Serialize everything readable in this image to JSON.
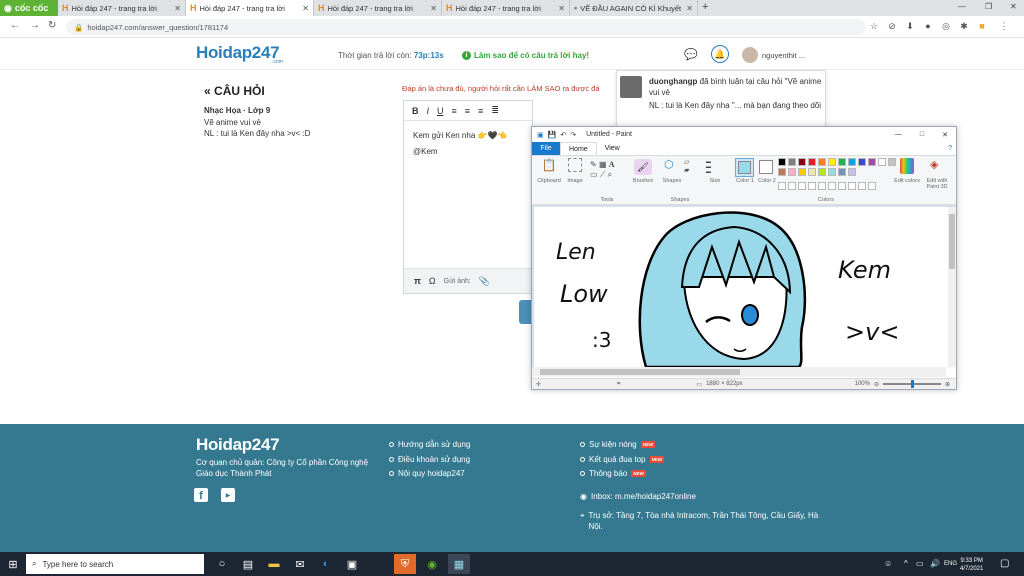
{
  "browser": {
    "brand": "cốc cốc",
    "tabs": [
      {
        "title": "Hỏi đáp 247 - trang tra lời",
        "active": false
      },
      {
        "title": "Hỏi đáp 247 - trang tra lời",
        "active": true
      },
      {
        "title": "Hỏi đáp 247 - trang tra lời",
        "active": false
      },
      {
        "title": "Hỏi đáp 247 - trang tra lời",
        "active": false
      },
      {
        "title": "VẼ ĐẦU AGAIN CÓ KÌ Khuyết",
        "active": false
      }
    ],
    "url": "hoidap247.com/answer_question/1781174"
  },
  "site": {
    "logo": "Hoidap247",
    "logo_sub": ".com",
    "timer_label": "Thời gian trả lời còn:",
    "timer_value": "73p:13s",
    "howto": "Làm sao để có câu trả lời hay!",
    "username": "nguyenthit ..."
  },
  "question": {
    "back_title": "CÂU HỎI",
    "subject": "Nhạc Họa · Lớp 9",
    "line1": "Vẽ anime vui vẻ",
    "line2": "NL : tui là Ken đây nha >v< :D",
    "notice": "Đáp án là chưa đủ, người hỏi rất cần LÀM SAO ra được đá"
  },
  "editor": {
    "toolbar": [
      "B",
      "I",
      "U"
    ],
    "content_line1": "Kem gửi Ken nha 👉🖤👈",
    "content_line2": "@Kem",
    "bottom_pi": "π",
    "bottom_omega": "Ω",
    "bottom_attach": "Gửi ảnh:"
  },
  "notification": {
    "name": "duonghangp",
    "action": "đã bình luận tại câu hỏi \"Vẽ anime vui vẻ",
    "text": "NL : tui là Ken đây nha \"... mà bạn đang theo dõi"
  },
  "paint": {
    "title": "Untitled - Paint",
    "menu": [
      "File",
      "Home",
      "View"
    ],
    "groups": {
      "clipboard": "Clipboard",
      "image": "Image",
      "tools": "Tools",
      "brushes": "Brushes",
      "shapes": "Shapes",
      "size": "Size",
      "color1": "Color 1",
      "color2": "Color 2",
      "edit_colors": "Edit colors",
      "edit_3d": "Edit with Paint 3D",
      "colors": "Colors"
    },
    "swatches": [
      "#000000",
      "#7f7f7f",
      "#880015",
      "#ed1c24",
      "#ff7f27",
      "#fff200",
      "#22b14c",
      "#00a2e8",
      "#3f48cc",
      "#a349a4",
      "#ffffff",
      "#c3c3c3",
      "#b97a57",
      "#ffaec9",
      "#ffc90e",
      "#efe4b0",
      "#b5e61d",
      "#99d9ea",
      "#7092be",
      "#c8bfe7"
    ],
    "color1": "#99d9ea",
    "canvas_size": "1880 × 822px",
    "zoom": "100%",
    "drawing_text": {
      "left1": "Len",
      "left2": "Low",
      "left3": ":3",
      "right1": "Kem",
      "right2": ">v<"
    }
  },
  "footer": {
    "logo": "Hoidap247",
    "owner": "Cơ quan chủ quản: Công ty Cổ phần Công nghệ Giáo dục Thành Phát",
    "col1": [
      "Hướng dẫn sử dụng",
      "Điều khoản sử dụng",
      "Nội quy hoidap247"
    ],
    "col2": [
      "Sự kiện nóng",
      "Kết quả đua top",
      "Thông báo"
    ],
    "new_badge": "NEW",
    "inbox": "Inbox: m.me/hoidap247online",
    "address": "Trụ sở: Tầng 7, Tòa nhà Intracom, Trần Thái Tông, Cầu Giấy, Hà Nội."
  },
  "taskbar": {
    "search_placeholder": "Type here to search",
    "lang": "ENG",
    "time": "9:33 PM",
    "date": "4/7/2021"
  }
}
